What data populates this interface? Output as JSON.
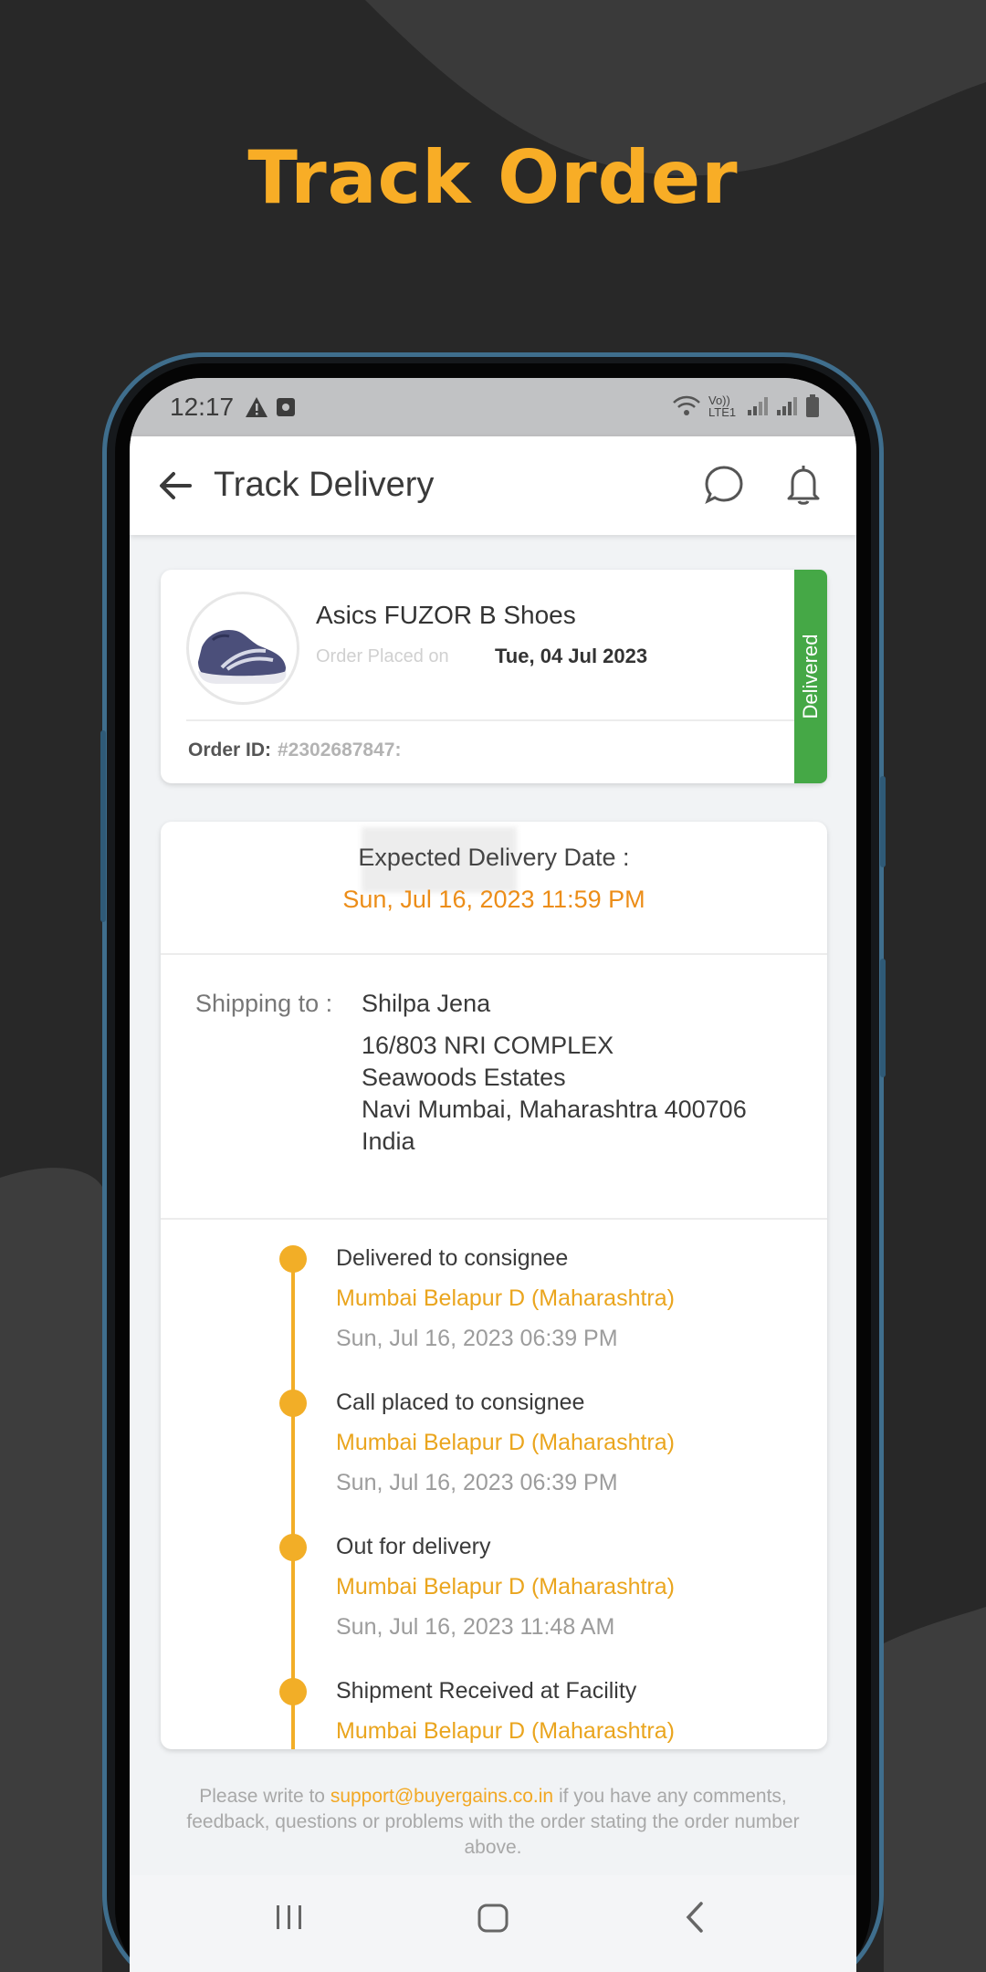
{
  "promo": {
    "title": "Track Order"
  },
  "status_bar": {
    "time": "12:17",
    "net_label": "Vo)) LTE1"
  },
  "app_bar": {
    "title": "Track Delivery"
  },
  "order": {
    "product_name": "Asics FUZOR B Shoes",
    "placed_label": "Order Placed on",
    "placed_date": "Tue, 04 Jul 2023",
    "order_id_label": "Order ID:",
    "order_id_value": "#2302687847:",
    "status": "Delivered"
  },
  "delivery": {
    "expected_label": "Expected Delivery Date :",
    "expected_date": "Sun, Jul 16, 2023 11:59 PM",
    "shipping_label": "Shipping to :",
    "name": "Shilpa Jena",
    "address": [
      "16/803 NRI COMPLEX",
      "Seawoods Estates",
      "Navi Mumbai, Maharashtra 400706",
      "India"
    ]
  },
  "events": [
    {
      "title": "Delivered to consignee",
      "location": "Mumbai Belapur D (Maharashtra)",
      "time": "Sun, Jul 16, 2023 06:39 PM"
    },
    {
      "title": "Call placed to consignee",
      "location": "Mumbai Belapur D (Maharashtra)",
      "time": "Sun, Jul 16, 2023 06:39 PM"
    },
    {
      "title": "Out for delivery",
      "location": "Mumbai Belapur D (Maharashtra)",
      "time": "Sun, Jul 16, 2023 11:48 AM"
    },
    {
      "title": "Shipment Received at Facility",
      "location": "Mumbai Belapur D (Maharashtra)",
      "time": ""
    }
  ],
  "footer": {
    "prefix": "Please write to",
    "email": "support@buyergains.co.in",
    "suffix": "if you have any comments, feedback, questions or problems with the order stating the order number above."
  },
  "colors": {
    "accent": "#f2ae27",
    "delivered": "#45a846",
    "background": "#282828"
  },
  "icons": [
    "back-arrow-icon",
    "chat-bubble-icon",
    "bell-icon",
    "wifi-icon",
    "signal-icon",
    "battery-icon",
    "recent-apps-icon",
    "home-icon",
    "nav-back-icon"
  ]
}
